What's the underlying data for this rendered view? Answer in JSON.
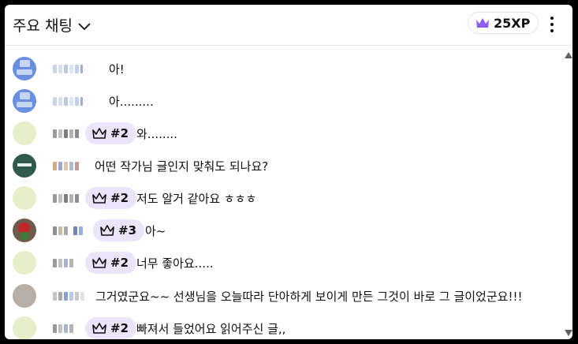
{
  "header": {
    "title": "주요 채팅",
    "xp": "25XP"
  },
  "colors": {
    "accent_purple": "#8c5cf0",
    "badge_bg": "#ece4fb"
  },
  "icons": {
    "dropdown": "chevron-down-icon",
    "xp": "crown-icon",
    "more": "more-vertical-icon",
    "badge": "crown-outline-icon"
  },
  "messages": [
    {
      "text": "아!",
      "badge": ""
    },
    {
      "text": "아.........",
      "badge": ""
    },
    {
      "text": "와........",
      "badge": "#2"
    },
    {
      "text": "어떤 작가님 글인지 맞춰도 되나요?",
      "badge": ""
    },
    {
      "text": "저도 알거 같아요 ㅎㅎㅎ",
      "badge": "#2"
    },
    {
      "text": "아~",
      "badge": "#3"
    },
    {
      "text": "너무 좋아요.....",
      "badge": "#2"
    },
    {
      "text": "그거였군요~~ 선생님을 오늘따라 단아하게 보이게 만든 그것이 바로 그 글이었군요!!!",
      "badge": ""
    },
    {
      "text": "빠져서 들었어요 읽어주신 글,,",
      "badge": "#2"
    }
  ]
}
